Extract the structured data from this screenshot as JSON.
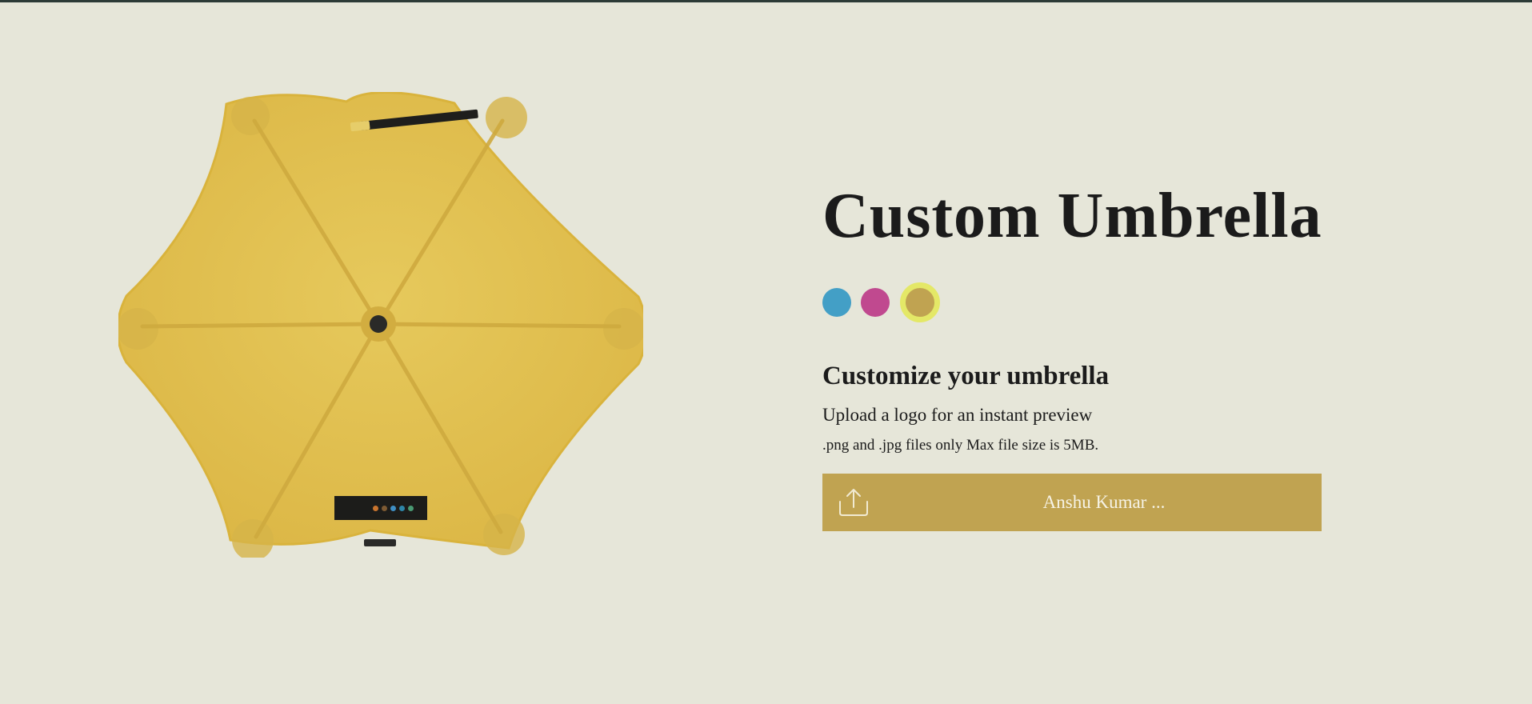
{
  "page": {
    "top_border_color": "#2d3b37",
    "background": "#e6e6d9"
  },
  "preview": {
    "umbrella_color": "#e3c14e",
    "icon": "umbrella-top-view-icon",
    "logo_badge_colors": [
      "#c8742e",
      "#7d5a33",
      "#3f8fc4",
      "#2e86a8",
      "#4a9a73"
    ]
  },
  "product": {
    "title": "Custom Umbrella"
  },
  "colors": {
    "options": [
      {
        "name": "blue",
        "hex": "#439fc6",
        "selected": false
      },
      {
        "name": "pink",
        "hex": "#c0498f",
        "selected": false
      },
      {
        "name": "yellow",
        "hex": "#c0a351",
        "selected": true
      }
    ],
    "selected_ring": "#e4e867"
  },
  "customize": {
    "heading": "Customize your umbrella",
    "description": "Upload a logo for an instant preview",
    "note": ".png and .jpg files only Max file size is 5MB."
  },
  "upload": {
    "label": "Anshu Kumar ...",
    "icon": "upload-icon",
    "background": "#c0a351"
  }
}
